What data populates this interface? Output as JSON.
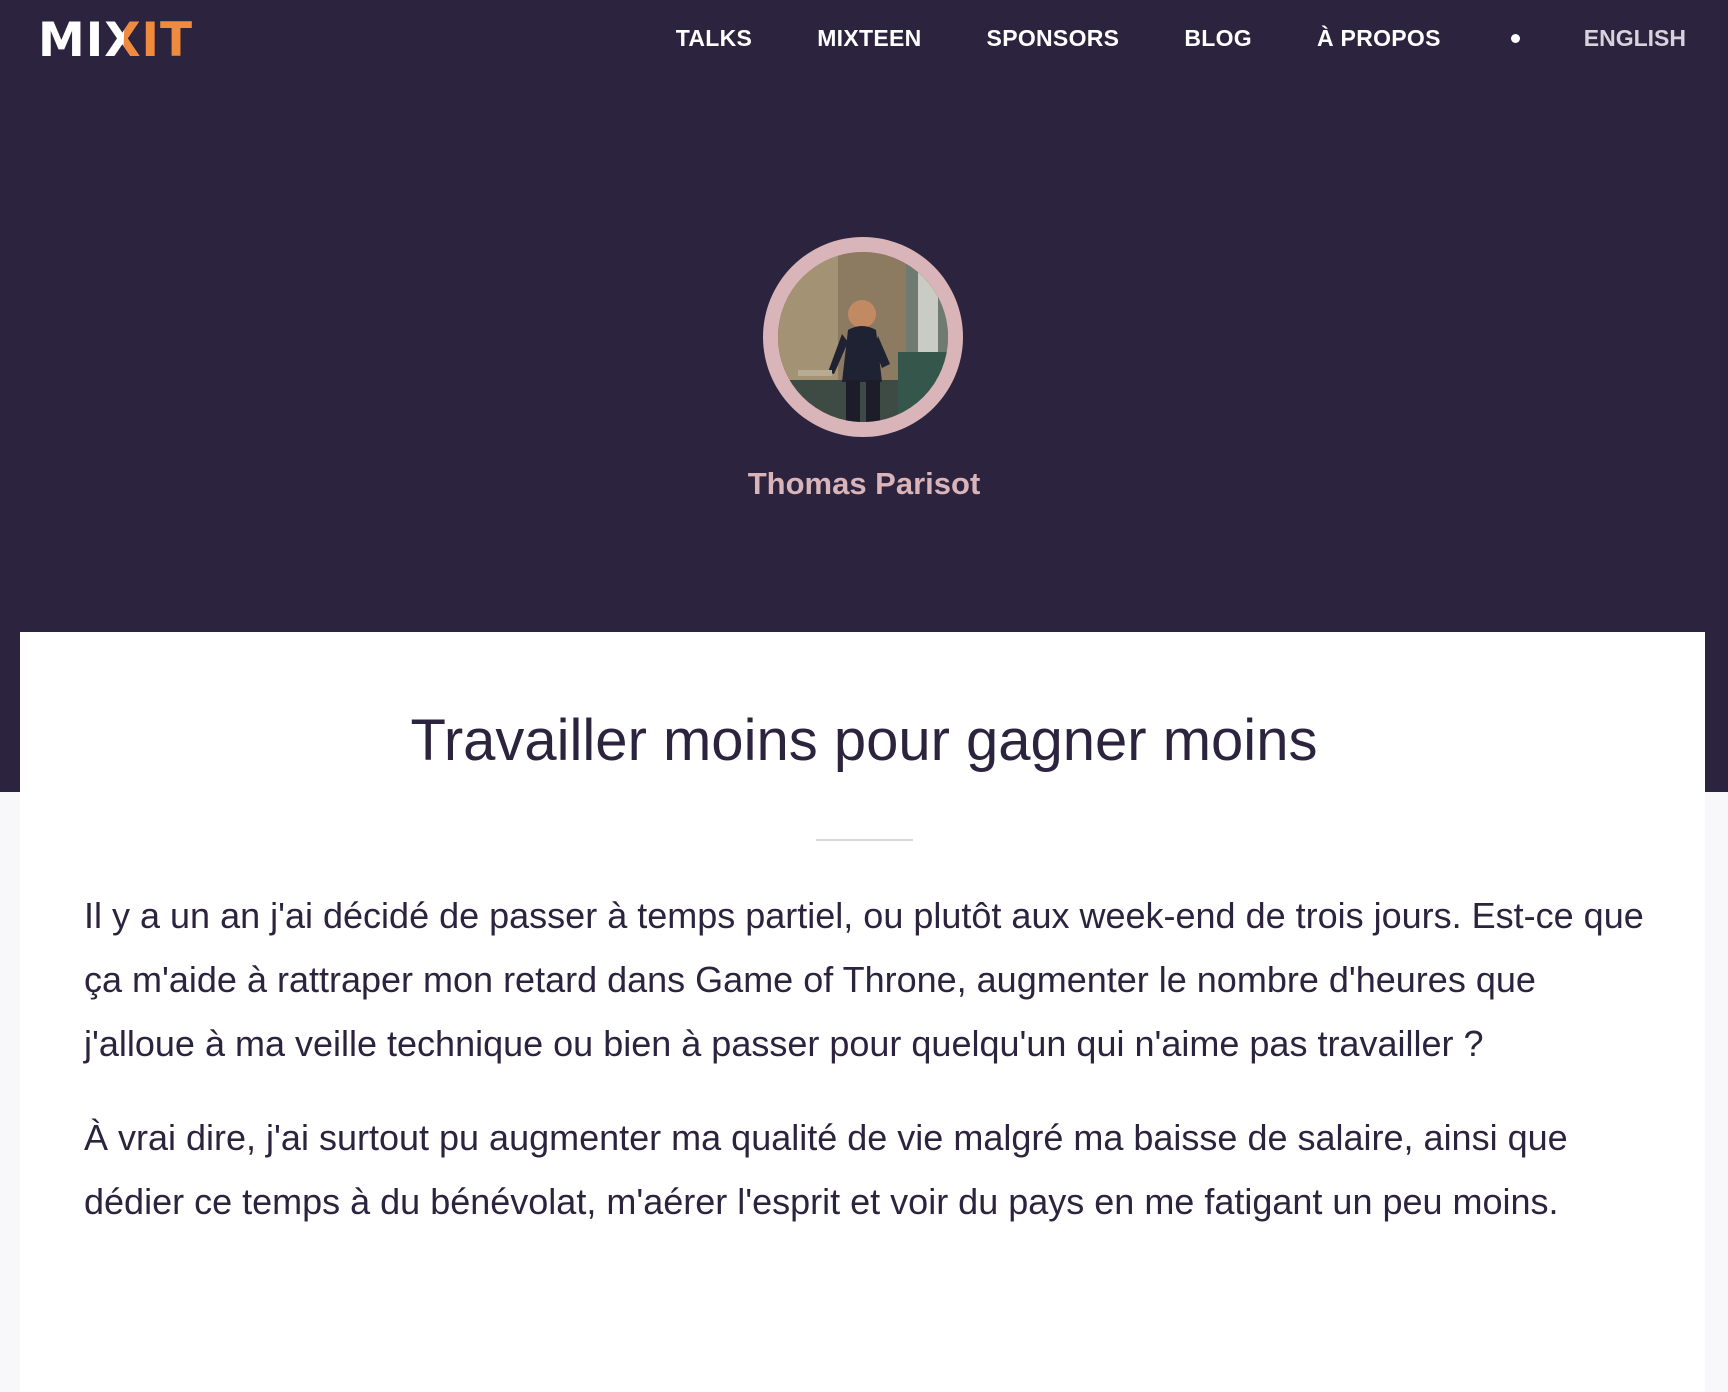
{
  "nav": {
    "logo": {
      "mi": "MI",
      "x": "X",
      "it": "IT"
    },
    "links": [
      "TALKS",
      "MIXTEEN",
      "SPONSORS",
      "BLOG",
      "À PROPOS"
    ],
    "language": "ENGLISH"
  },
  "speaker": {
    "name": "Thomas Parisot"
  },
  "talk": {
    "title": "Travailler moins pour gagner moins",
    "paragraphs": [
      "Il y a un an j'ai décidé de passer à temps partiel, ou plutôt aux week-end de trois jours. Est-ce que ça m'aide à rattraper mon retard dans Game of Throne, augmenter le nombre d'heures que j'alloue à ma veille technique ou bien à passer pour quelqu'un qui n'aime pas travailler ?",
      "À vrai dire, j'ai surtout pu augmenter ma qualité de vie malgré ma baisse de salaire, ainsi que dédier ce temps à du bénévolat, m'aérer l'esprit et voir du pays en me fatigant un peu moins."
    ]
  },
  "colors": {
    "hero_background": "#2c243e",
    "accent_orange": "#f08a3c",
    "speaker_pink": "#d9b4b9",
    "text_dark": "#2c243e"
  }
}
